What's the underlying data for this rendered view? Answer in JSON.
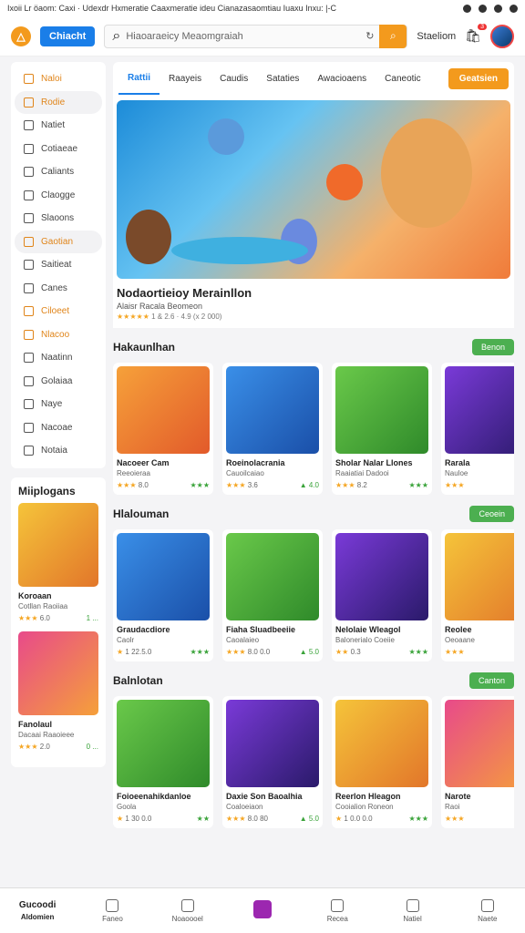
{
  "statusbar": {
    "left": "Ixoii Lr öaom: Caxi · Udexdr Hxmeratie Caaxmeratie ideu Cianazasaomtiau Iuaxu Inxu: |-C"
  },
  "header": {
    "logo_label": "Chiacht",
    "search_placeholder": "Hiaoaraeicy Meaomgraiah",
    "signin_label": "Staeliom",
    "cart_count": "3"
  },
  "tabs": [
    {
      "label": "Rattii",
      "active": true
    },
    {
      "label": "Raayeis"
    },
    {
      "label": "Caudis"
    },
    {
      "label": "Sataties"
    },
    {
      "label": "Awacioaens"
    },
    {
      "label": "Caneotic"
    }
  ],
  "tab_cta": "Geatsien",
  "sidebar": [
    {
      "label": "Naloi",
      "orange": true
    },
    {
      "label": "Rodie",
      "orange": true,
      "active": true
    },
    {
      "label": "Natiet"
    },
    {
      "label": "Cotiaeae"
    },
    {
      "label": "Caliants"
    },
    {
      "label": "Claogge"
    },
    {
      "label": "Slaoons"
    },
    {
      "label": "Gaotian",
      "orange": true,
      "active": true
    },
    {
      "label": "Saitieat"
    },
    {
      "label": "Canes"
    },
    {
      "label": "Ciloeet",
      "orange": true
    },
    {
      "label": "Nlacoo",
      "orange": true
    },
    {
      "label": "Naatinn"
    },
    {
      "label": "Golaiaa"
    },
    {
      "label": "Naye"
    },
    {
      "label": "Nacoae"
    },
    {
      "label": "Notaia"
    }
  ],
  "hero": {
    "title": "Nodaortieioy Merainllon",
    "subtitle": "Alaisr Racala Beomeon",
    "rating_stars": "★★★★★",
    "rating_text": "1 & 2.6 · 4.9 (x 2 000)"
  },
  "sections": [
    {
      "title": "Hakaunlhan",
      "button": "Benon",
      "cards": [
        {
          "name": "Nacoeer Cam",
          "sub": "Reeoieraa",
          "stars": "★★★",
          "left": "8.0",
          "right": "★★★"
        },
        {
          "name": "Roeinolacrania",
          "sub": "Cauoilcaiao",
          "stars": "★★★",
          "left": "3.6",
          "right": "▲ 4.0"
        },
        {
          "name": "Sholar Nalar Llones",
          "sub": "Raaiatiai Dadooi",
          "stars": "★★★",
          "left": "8.2",
          "right": "★★★"
        },
        {
          "name": "Rarala",
          "sub": "Nauloe",
          "stars": "★★★",
          "left": "",
          "right": ""
        }
      ]
    },
    {
      "title": "Hlalouman",
      "button": "Ceoein",
      "cards": [
        {
          "name": "Graudacdiore",
          "sub": "Caolr",
          "stars": "★",
          "left": "1 22.5.0",
          "right": "★★★"
        },
        {
          "name": "Fiaha Sluadbeeiie",
          "sub": "Caoalaieo",
          "stars": "★★★",
          "left": "8.0 0.0",
          "right": "▲ 5.0"
        },
        {
          "name": "Nelolaie Wleagol",
          "sub": "Balonerialo Coeiie",
          "stars": "★★",
          "left": "0.3",
          "right": "★★★"
        },
        {
          "name": "Reolee",
          "sub": "Oeoaane",
          "stars": "★★★",
          "left": "",
          "right": ""
        }
      ]
    },
    {
      "title": "Balnlotan",
      "button": "Canton",
      "cards": [
        {
          "name": "Foioeenahikdanloe",
          "sub": "Goola",
          "stars": "★",
          "left": "1 30 0.0",
          "right": "★★"
        },
        {
          "name": "Daxie Son Baoalhia",
          "sub": "Coaloeiaon",
          "stars": "★★★",
          "left": "8.0 80",
          "right": "▲ 5.0"
        },
        {
          "name": "Reerlon Hleagon",
          "sub": "Cooialion Roneon",
          "stars": "★",
          "left": "1 0.0 0.0",
          "right": "★★★"
        },
        {
          "name": "Narote",
          "sub": "Raoi",
          "stars": "★★★",
          "left": "",
          "right": ""
        }
      ]
    }
  ],
  "left_section": {
    "title": "Miiplogans",
    "cards": [
      {
        "name": "Koroaan",
        "sub": "Cotllan Raoiiaa",
        "stars": "★★★",
        "left": "6.0",
        "right": "1 ..."
      },
      {
        "name": "Fanolaul",
        "sub": "Dacaai Raaoieee",
        "stars": "★★★",
        "left": "2.0",
        "right": "0 ..."
      }
    ]
  },
  "bottom_nav": [
    {
      "label": "Aldomien",
      "top": "Gucoodi",
      "first": true
    },
    {
      "label": "Faneo"
    },
    {
      "label": "Noaoooel"
    },
    {
      "label": "",
      "center": true
    },
    {
      "label": "Recea"
    },
    {
      "label": "Natiel"
    },
    {
      "label": "Naete"
    }
  ]
}
